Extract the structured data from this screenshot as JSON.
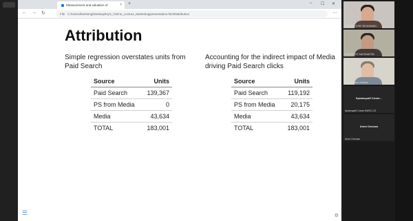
{
  "browser": {
    "tab_title": "Measurement and valuation of",
    "url": "C:/Users/Ilamtong/Desktop/Kyiv_Online_Lecture_Marketing/presentation.html#attribution",
    "file_label": "File"
  },
  "slide": {
    "title": "Attribution",
    "left": {
      "heading": "Simple regression overstates units from Paid Search",
      "headers": [
        "Source",
        "Units"
      ],
      "rows": [
        [
          "Paid Search",
          "139,367"
        ],
        [
          "PS from Media",
          "0"
        ],
        [
          "Media",
          "43,634"
        ],
        [
          "TOTAL",
          "183,001"
        ]
      ]
    },
    "right": {
      "heading": "Accounting for the indirect impact of Media driving Paid Search clicks",
      "headers": [
        "Source",
        "Units"
      ],
      "rows": [
        [
          "Paid Search",
          "119,192"
        ],
        [
          "PS from Media",
          "20,175"
        ],
        [
          "Media",
          "43,634"
        ],
        [
          "TOTAL",
          "183,001"
        ]
      ]
    }
  },
  "participants": [
    {
      "name": "ФИРЦЕВ ОЛЕГ ВЕНИАМИН"
    },
    {
      "name": "ЮЛЬЯЛЕНТ МАТЕМАРОВ"
    },
    {
      "name": "John Gordon-Geddes"
    },
    {
      "display": "Кривоцкий Сатан...",
      "name": "Кривоцкий Сатан БМ921-23"
    },
    {
      "display": "Анна Олешко",
      "name": "Анна Олешко"
    }
  ],
  "icons": {
    "menu": "hamburger-icon",
    "settings": "gear-icon"
  }
}
